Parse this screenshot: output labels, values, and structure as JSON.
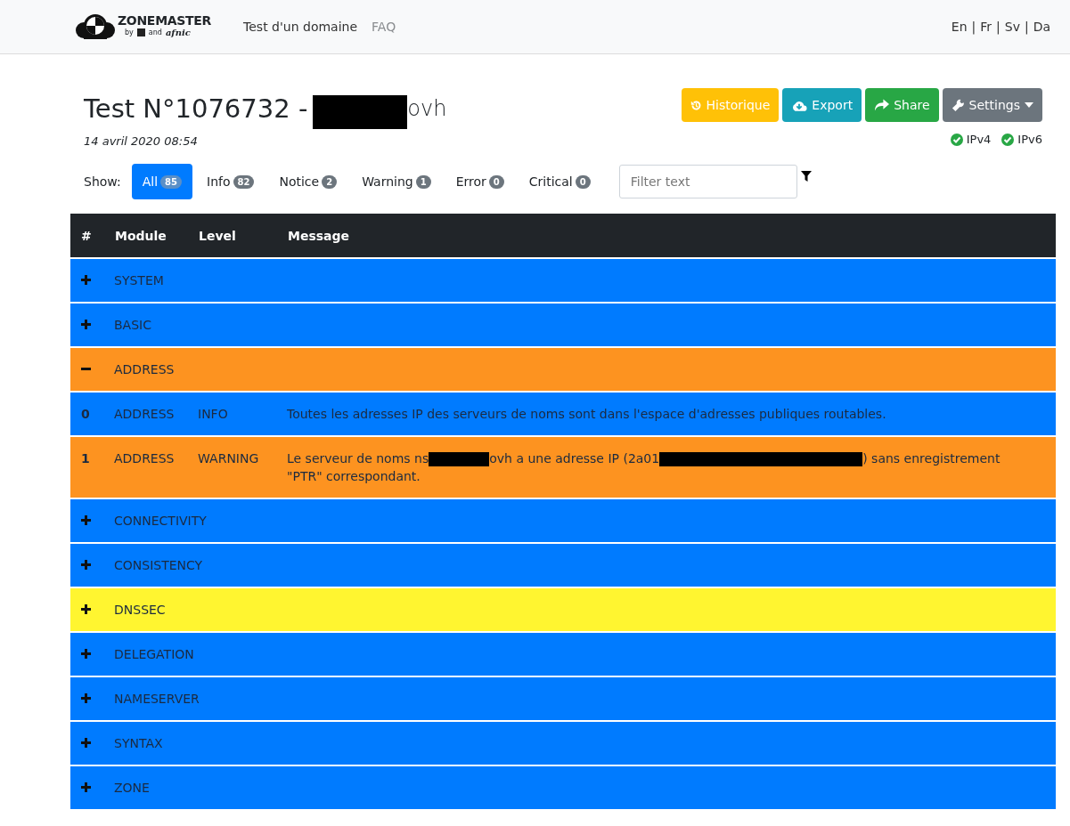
{
  "navbar": {
    "brand": {
      "name": "ZONEMASTER",
      "byline": "by",
      "and": "and",
      "partner": "afnic"
    },
    "links": [
      {
        "label": "Test d'un domaine",
        "selected": true
      },
      {
        "label": "FAQ",
        "selected": false
      }
    ],
    "languages": [
      "En",
      "Fr",
      "Sv",
      "Da"
    ],
    "language_separator": "|"
  },
  "header": {
    "title_prefix": "Test N°1076732 -",
    "title_suffix": "ovh",
    "date": "14 avril 2020 08:54",
    "buttons": [
      {
        "kind": "history",
        "label": "Historique"
      },
      {
        "kind": "export",
        "label": "Export"
      },
      {
        "kind": "share",
        "label": "Share"
      },
      {
        "kind": "settings",
        "label": "Settings"
      }
    ],
    "protocols": [
      {
        "label": "IPv4",
        "checked": true
      },
      {
        "label": "IPv6",
        "checked": true
      }
    ]
  },
  "filters": {
    "label": "Show:",
    "items": [
      {
        "label": "All",
        "count": "85",
        "selected": true
      },
      {
        "label": "Info",
        "count": "82",
        "selected": false
      },
      {
        "label": "Notice",
        "count": "2",
        "selected": false
      },
      {
        "label": "Warning",
        "count": "1",
        "selected": false
      },
      {
        "label": "Error",
        "count": "0",
        "selected": false
      },
      {
        "label": "Critical",
        "count": "0",
        "selected": false
      }
    ],
    "search": {
      "placeholder": "Filter text"
    }
  },
  "table": {
    "columns": [
      "#",
      "Module",
      "Level",
      "Message"
    ],
    "rows": [
      {
        "kind": "group",
        "module": "SYSTEM",
        "expanded": false,
        "color": "#007bff"
      },
      {
        "kind": "group",
        "module": "BASIC",
        "expanded": false,
        "color": "#007bff"
      },
      {
        "kind": "group",
        "module": "ADDRESS",
        "expanded": true,
        "color": "#fd9320"
      },
      {
        "kind": "message",
        "index": "0",
        "module": "ADDRESS",
        "level": "INFO",
        "color": "#007bff",
        "message": [
          {
            "kind": "text",
            "text": "Toutes les adresses IP des serveurs de noms sont dans l'espace d'adresses publiques routables."
          }
        ]
      },
      {
        "kind": "message",
        "index": "1",
        "module": "ADDRESS",
        "level": "WARNING",
        "color": "#fd9320",
        "message": [
          {
            "kind": "text",
            "text": "Le serveur de noms ns"
          },
          {
            "kind": "redacted"
          },
          {
            "kind": "text",
            "text": "ovh a une adresse IP (2a01"
          },
          {
            "kind": "redacted_long"
          },
          {
            "kind": "text",
            "text": ") sans enregistrement \"PTR\" correspondant."
          }
        ]
      },
      {
        "kind": "group",
        "module": "CONNECTIVITY",
        "expanded": false,
        "color": "#007bff"
      },
      {
        "kind": "group",
        "module": "CONSISTENCY",
        "expanded": false,
        "color": "#007bff"
      },
      {
        "kind": "group",
        "module": "DNSSEC",
        "expanded": false,
        "color": "#fff530"
      },
      {
        "kind": "group",
        "module": "DELEGATION",
        "expanded": false,
        "color": "#007bff"
      },
      {
        "kind": "group",
        "module": "NAMESERVER",
        "expanded": false,
        "color": "#007bff"
      },
      {
        "kind": "group",
        "module": "SYNTAX",
        "expanded": false,
        "color": "#007bff"
      },
      {
        "kind": "group",
        "module": "ZONE",
        "expanded": false,
        "color": "#007bff"
      }
    ]
  }
}
